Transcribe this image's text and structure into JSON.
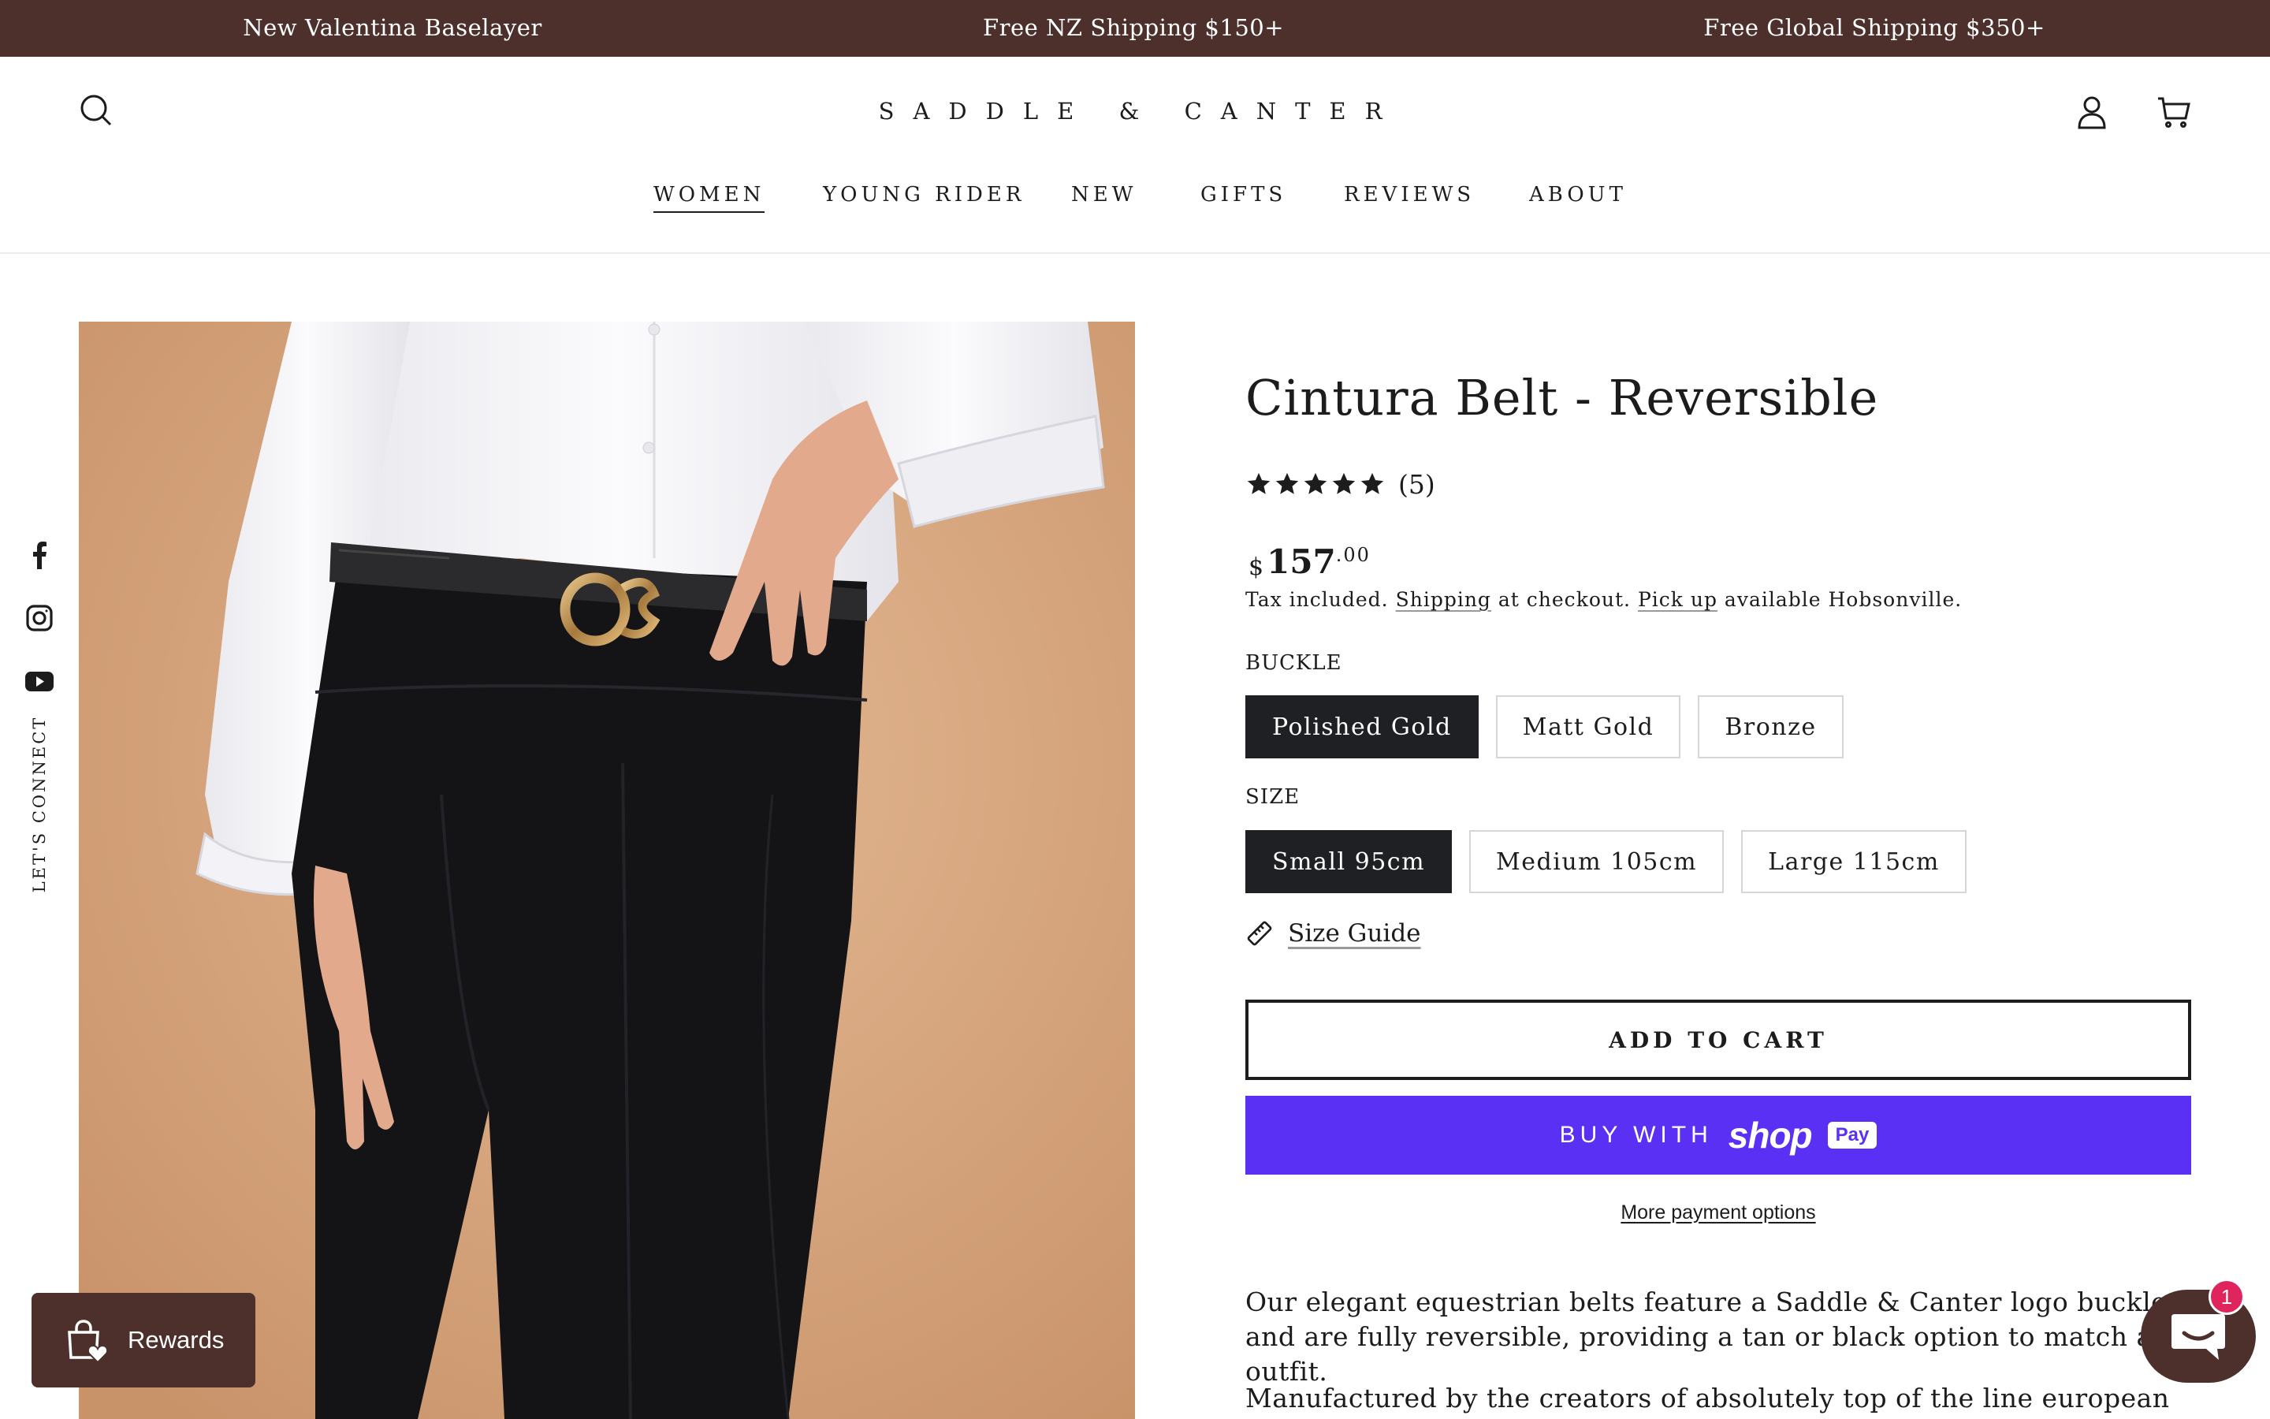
{
  "announcement": {
    "messages": [
      "New Valentina Baselayer",
      "Free NZ Shipping $150+",
      "Free Global Shipping $350+"
    ],
    "background": "#4d302c"
  },
  "header": {
    "logo": "SADDLE & CANTER",
    "icons": {
      "search": "search-icon",
      "account": "user-icon",
      "cart": "cart-icon"
    },
    "nav": [
      "WOMEN",
      "YOUNG RIDER",
      "NEW",
      "GIFTS",
      "REVIEWS",
      "ABOUT"
    ],
    "active_nav": "WOMEN"
  },
  "social": {
    "icons": [
      "facebook-icon",
      "instagram-icon",
      "youtube-icon"
    ],
    "label": "LET'S CONNECT"
  },
  "product": {
    "title": "Cintura Belt - Reversible",
    "rating": {
      "stars": 5,
      "count": "(5)"
    },
    "price": {
      "currency": "$",
      "whole": "157",
      "cents": ".00"
    },
    "tax_note": {
      "part1": "Tax included.",
      "shipping_link": "Shipping",
      "part2": "at checkout.",
      "pickup_link": "Pick up",
      "part3": "available Hobsonville."
    },
    "buckle": {
      "label": "BUCKLE",
      "options": [
        "Polished Gold",
        "Matt Gold",
        "Bronze"
      ],
      "selected": "Polished Gold"
    },
    "size": {
      "label": "SIZE",
      "options": [
        "Small 95cm",
        "Medium 105cm",
        "Large 115cm"
      ],
      "selected": "Small 95cm"
    },
    "size_guide": "Size Guide",
    "add_to_cart": "ADD TO CART",
    "shop_pay": {
      "buy_with": "BUY WITH",
      "brand": "shop",
      "pay": "Pay",
      "color": "#5a31f4"
    },
    "more_payments": "More payment options",
    "description": [
      "Our elegant equestrian belts feature a Saddle & Canter logo buckle and are fully reversible, providing a tan or black option to match any outfit.",
      "Manufactured by the creators of absolutely top of the line european designer"
    ]
  },
  "rewards": {
    "label": "Rewards"
  },
  "chat": {
    "badge": "1"
  }
}
